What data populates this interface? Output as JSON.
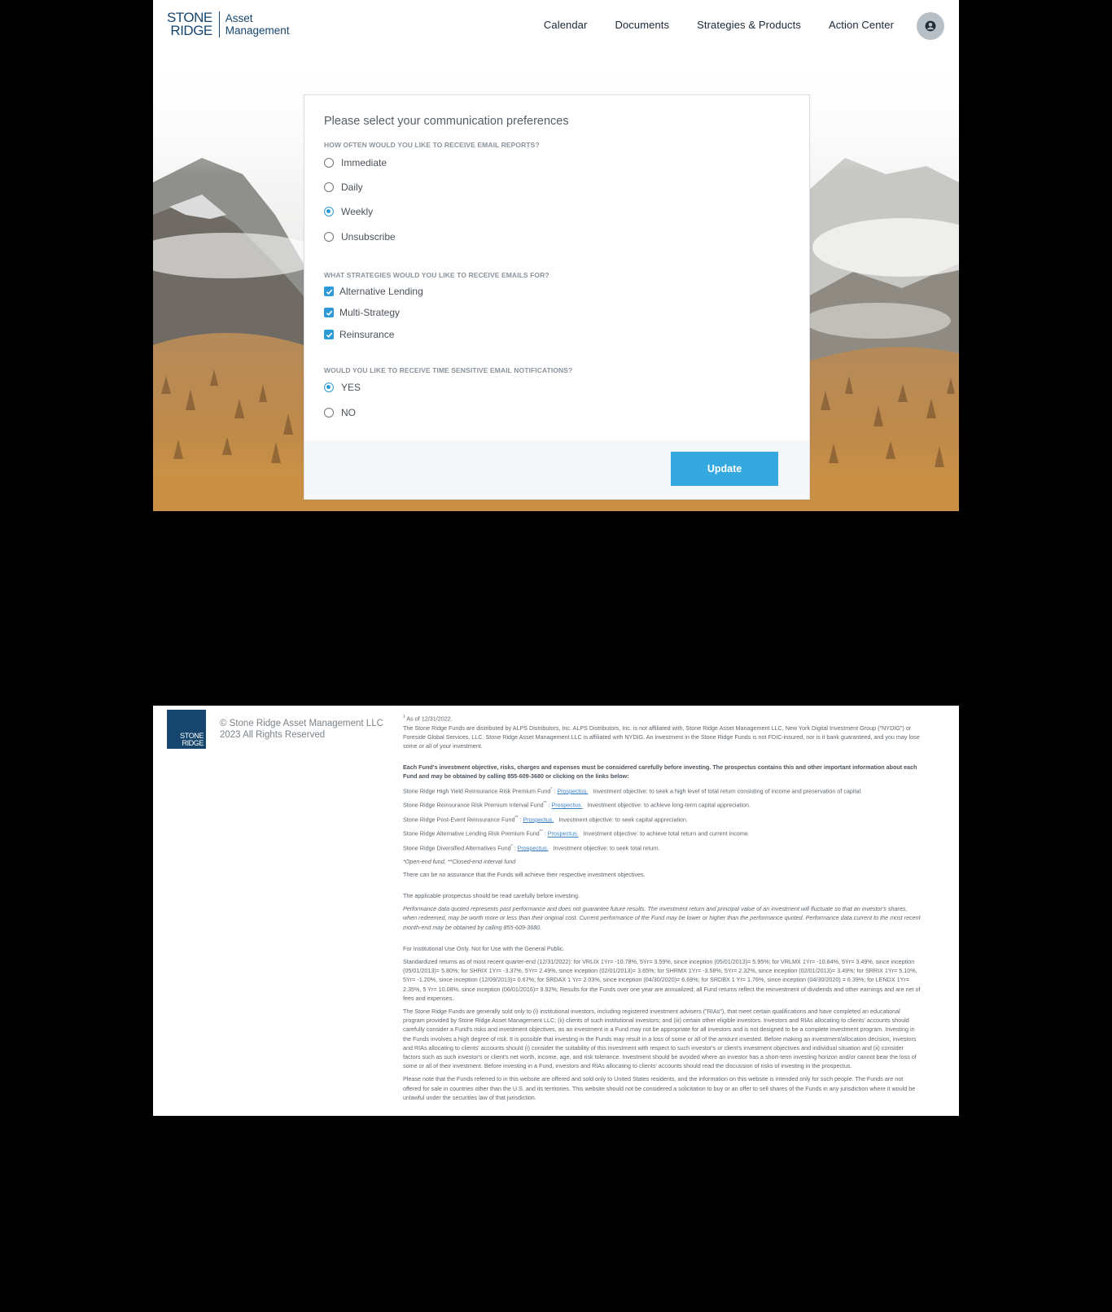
{
  "header": {
    "logo_line1": "STONE",
    "logo_line2": "RIDGE",
    "logo_sub1": "Asset",
    "logo_sub2": "Management",
    "nav": [
      "Calendar",
      "Documents",
      "Strategies & Products",
      "Action Center"
    ],
    "avatar_icon": "user-circle-icon"
  },
  "form": {
    "title": "Please select your communication preferences",
    "q1": "HOW OFTEN WOULD YOU LIKE TO RECEIVE EMAIL REPORTS?",
    "q1_options": [
      "Immediate",
      "Daily",
      "Weekly",
      "Unsubscribe"
    ],
    "q1_selected": "Weekly",
    "q2": "WHAT STRATEGIES WOULD YOU LIKE TO RECEIVE EMAILS FOR?",
    "q2_options": [
      "Alternative Lending",
      "Multi-Strategy",
      "Reinsurance"
    ],
    "q2_checked": [
      true,
      true,
      true
    ],
    "q3": "WOULD YOU LIKE TO RECEIVE TIME SENSITIVE EMAIL NOTIFICATIONS?",
    "q3_options": [
      "YES",
      "NO"
    ],
    "q3_selected": "YES",
    "update_label": "Update",
    "accent_color": "#35a8e0"
  },
  "footer": {
    "logo_line1": "STONE",
    "logo_line2": "RIDGE",
    "copyright_line1": "© Stone Ridge Asset Management LLC",
    "copyright_line2": "2023 All Rights Reserved",
    "asof": "As of 12/31/2022.",
    "dist": "The Stone Ridge Funds are distributed by ALPS Distributors, Inc. ALPS Distributors, Inc. is not affiliated with, Stone Ridge Asset Management LLC, New York Digital Investment Group (\"NYDIG\") or Foreside Global Services, LLC. Stone Ridge Asset Management LLC is affiliated with NYDIG. An investment in the Stone Ridge Funds is not FDIC-insured, nor is it bank guaranteed, and you may lose some or all of your investment.",
    "bold_notice": "Each Fund's investment objective, risks, charges and expenses must be considered carefully before investing. The prospectus contains this and other important information about each Fund and may be obtained by calling 855-609-3680 or clicking on the links below:",
    "funds": [
      {
        "name": "Stone Ridge High Yield Reinsurance Risk Premium Fund",
        "mark": "*",
        "link": "Prospectus.",
        "objective": "Investment objective: to seek a high level of total return consisting of income and preservation of capital."
      },
      {
        "name": "Stone Ridge Reinsurance Risk Premium Interval Fund",
        "mark": "**",
        "link": "Prospectus.",
        "objective": "Investment objective: to achieve long-term capital appreciation."
      },
      {
        "name": "Stone Ridge Post-Event Reinsurance Fund",
        "mark": "**",
        "link": "Prospectus.",
        "objective": "Investment objective: to seek capital appreciation."
      },
      {
        "name": "Stone Ridge Alternative Lending Risk Premium Fund",
        "mark": "**",
        "link": "Prospectus.",
        "objective": "Investment objective: to achieve total return and current income."
      },
      {
        "name": "Stone Ridge Diversified Alternatives Fund",
        "mark": "*",
        "link": "Prospectus.",
        "objective": "Investment objective: to seek total return."
      }
    ],
    "fund_types": "*Open-end fund, **Closed-end interval fund",
    "no_assurance": "There can be no assurance that the Funds will achieve their respective investment objectives.",
    "read_prospectus": "The applicable prospectus should be read carefully before investing.",
    "performance": "Performance data quoted represents past performance and does not guarantee future results. The investment return and principal value of an investment will fluctuate so that an investor's shares, when redeemed, may be worth more or less than their original cost. Current performance of the Fund may be lower or higher than the performance quoted. Performance data current to the most recent month-end may be obtained by calling 855-609-3680.",
    "institutional": "For Institutional Use Only. Not for Use with the General Public.",
    "standardized": "Standardized returns as of most recent quarter-end (12/31/2022): for VRLIX 1Yr= -10.78%, 5Yr= 3.59%, since inception (05/01/2013)= 5.95%; for VRLMX 1Yr= -10.84%, 5Yr= 3.49%, since inception (05/01/2013)= 5.80%; for SHRIX 1Yr= -3.37%, 5Yr= 2.49%, since inception (02/01/2013)= 3.65%; for SHRMX 1Yr= -3.58%, 5Yr= 2.32%, since inception (02/01/2013)= 3.49%; for SRRIX 1Yr= 5.10%, 5Yr= -1.20%, since inception (12/09/2013)= 0.67%; for SRDAX 1 Yr= 2.03%, since inception (04/30/2020)= 6.69%; for SRDBX 1 Yr= 1.76%, since inception (04/30/2020) = 6.39%; for LENDX 1Yr= 2.35%, 5 Yr= 10.08%, since inception (06/01/2016)= 9.92%; Results for the Funds over one year are annualized; all Fund returns reflect the reinvestment of dividends and other earnings and are net of fees and expenses.",
    "sold_only": "The Stone Ridge Funds are generally sold only to (i) institutional investors, including registered investment advisers (\"RIAs\"), that meet certain qualifications and have completed an educational program provided by Stone Ridge Asset Management LLC; (ii) clients of such institutional investors; and (iii) certain other eligible investors. Investors and RIAs allocating to clients' accounts should carefully consider a Fund's risks and investment objectives, as an investment in a Fund may not be appropriate for all investors and is not designed to be a complete investment program. Investing in the Funds involves a high degree of risk. It is possible that investing in the Funds may result in a loss of some or all of the amount invested. Before making an investment/allocation decision, investors and RIAs allocating to clients' accounts should (i) consider the suitability of this investment with respect to such investor's or client's investment objectives and individual situation and (ii) consider factors such as such investor's or client's net worth, income, age, and risk tolerance. Investment should be avoided where an investor has a short-term investing horizon and/or cannot bear the loss of some or all of their investment. Before investing in a Fund, investors and RIAs allocating to clients' accounts should read the discussion of risks of investing in the prospectus.",
    "us_only": "Please note that the Funds referred to in this website are offered and sold only to United States residents, and the information on this website is intended only for such people. The Funds are not offered for sale in countries other than the U.S. and its territories. This website should not be considered a solicitation to buy or an offer to sell shares of the Funds in any jurisdiction where it would be unlawful under the securities law of that jurisdiction."
  }
}
